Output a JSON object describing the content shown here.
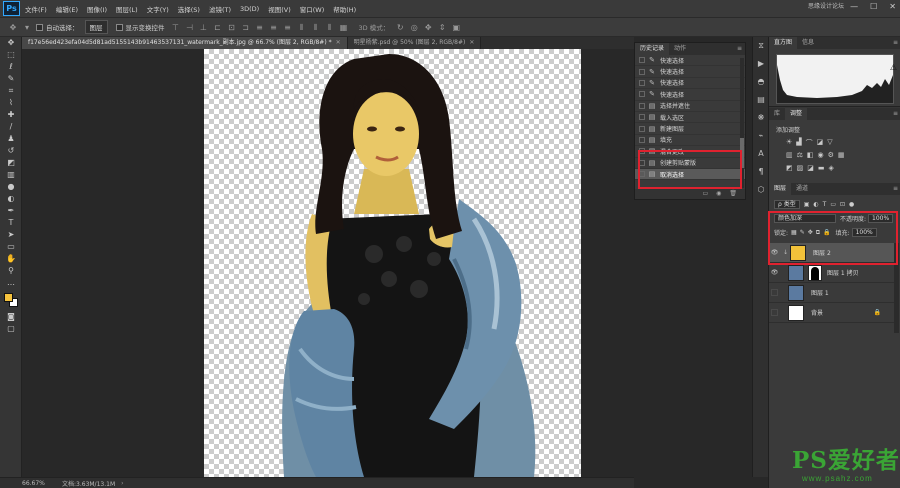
{
  "app": {
    "logo": "Ps"
  },
  "menu": [
    "文件(F)",
    "编辑(E)",
    "图像(I)",
    "图层(L)",
    "文字(Y)",
    "选择(S)",
    "滤镜(T)",
    "3D(D)",
    "视图(V)",
    "窗口(W)",
    "帮助(H)"
  ],
  "window_controls": {
    "minimize": "—",
    "maximize": "☐",
    "close": "✕"
  },
  "top_watermark": "思缘设计论坛",
  "options": {
    "auto_select_label": "自动选择：",
    "auto_select_value": "图层",
    "transform_label": "显示变换控件",
    "mode_3d": "3D 模式："
  },
  "tabs": [
    {
      "label": "f17e56ed423efa04d5d81ad5155143b91463537131_watermark_副本.jpg @ 66.7% (图层 2, RGB/8#) *",
      "active": true
    },
    {
      "label": "明星杨紫.psd @ 50% (图层 2, RGB/8#)",
      "active": false
    }
  ],
  "status": {
    "zoom": "66.67%",
    "doc": "文档:3.63M/13.1M"
  },
  "history": {
    "tabs": [
      "历史记录",
      "动作"
    ],
    "items": [
      {
        "label": "快速选择",
        "icon": "quick-select",
        "selected": false
      },
      {
        "label": "快速选择",
        "icon": "quick-select",
        "selected": false
      },
      {
        "label": "快速选择",
        "icon": "quick-select",
        "selected": false
      },
      {
        "label": "快速选择",
        "icon": "quick-select",
        "selected": false
      },
      {
        "label": "选择并遮住",
        "icon": "doc",
        "selected": false
      },
      {
        "label": "载入选区",
        "icon": "doc",
        "selected": false
      },
      {
        "label": "新建图层",
        "icon": "doc",
        "selected": false
      },
      {
        "label": "填充",
        "icon": "doc",
        "selected": false
      },
      {
        "label": "混合更改",
        "icon": "doc",
        "selected": false
      },
      {
        "label": "创建剪贴蒙版",
        "icon": "doc",
        "selected": false
      },
      {
        "label": "取消选择",
        "icon": "doc",
        "selected": true
      }
    ]
  },
  "histogram": {
    "tabs": [
      "直方图",
      "信息"
    ],
    "warning": "⚠"
  },
  "adjustments": {
    "tabs": [
      "库",
      "调整"
    ],
    "title": "添加调整"
  },
  "layers": {
    "tabs": [
      "图层",
      "通道"
    ],
    "filter_label": "ρ 类型",
    "blend_mode": "颜色加深",
    "opacity_label": "不透明度:",
    "opacity_value": "100%",
    "lock_label": "锁定:",
    "fill_label": "填充:",
    "fill_value": "100%",
    "items": [
      {
        "name": "图层 2",
        "visible": true,
        "selected": true,
        "thumb_color": "#f2c23a",
        "clipped": true
      },
      {
        "name": "图层 1 拷贝",
        "visible": true,
        "selected": false,
        "thumb_color": "#5b7aa0",
        "mask": true
      },
      {
        "name": "图层 1",
        "visible": false,
        "selected": false,
        "thumb_color": "#5b7aa0"
      },
      {
        "name": "背景",
        "visible": false,
        "selected": false,
        "thumb_color": "#ffffff",
        "locked": true
      }
    ]
  },
  "site_watermark": {
    "title": "PS爱好者",
    "url": "www.psahz.com"
  },
  "colors": {
    "accent": "#31a8ff",
    "highlight": "#e0222f",
    "watermark": "#3aa535",
    "foreground": "#f5c23d",
    "background": "#ffffff"
  }
}
